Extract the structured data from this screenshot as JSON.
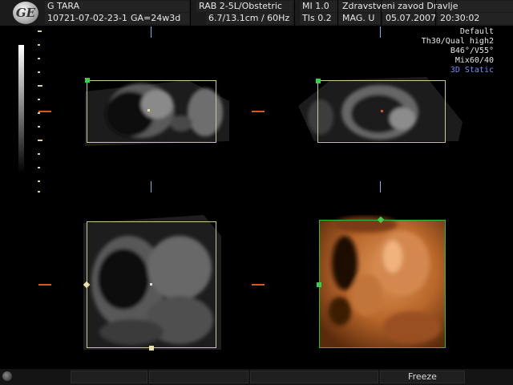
{
  "header": {
    "logo": "GE",
    "patient_name": "G TARA",
    "patient_id": "10721-07-02-23-11",
    "gestational_age": "GA=24w3d",
    "probe": "RAB 2-5L/Obstetric",
    "depth": "6.7/13.1cm / 60Hz",
    "mi": "MI  1.0",
    "tis": "TIs  0.2",
    "institution": "Zdravstveni zavod Dravlje",
    "mag": "MAG. U",
    "date": "05.07.2007",
    "time": "20:30:02"
  },
  "params": {
    "preset": "Default",
    "quality": "Th30/Qual high2",
    "angles": "B46°/V55°",
    "mix": "Mix60/40",
    "mode": "3D Static"
  },
  "footer": {
    "freeze_label": "Freeze"
  },
  "colors": {
    "accent": "#7a8cff",
    "box_yellow": "#cfc99a",
    "box_green": "#2dbb3a",
    "marker_orange": "#d25a1e"
  },
  "icons": [
    "ge-logo-icon",
    "grayscale-bar",
    "down-arrow-icon",
    "right-arrow-icon",
    "trackball-knob-icon"
  ]
}
